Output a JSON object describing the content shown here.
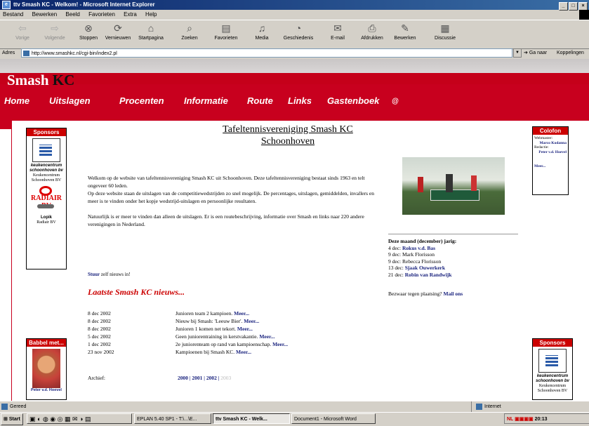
{
  "window": {
    "title": "ttv Smash KC - Welkom! - Microsoft Internet Explorer"
  },
  "menu": [
    "Bestand",
    "Bewerken",
    "Beeld",
    "Favorieten",
    "Extra",
    "Help"
  ],
  "toolbar": {
    "back": "Vorige",
    "forward": "Volgende",
    "stop": "Stoppen",
    "refresh": "Vernieuwen",
    "home": "Startpagina",
    "search": "Zoeken",
    "favorites": "Favorieten",
    "media": "Media",
    "history": "Geschiedenis",
    "mail": "E-mail",
    "print": "Afdrukken",
    "edit": "Bewerken",
    "discuss": "Discussie"
  },
  "address": {
    "label": "Adres",
    "url": "http://www.smashkc.nl/cgi-bin/index2.pl",
    "go": "Ga naar",
    "links": "Koppelingen"
  },
  "site": {
    "name_a": "Smash",
    "name_b": "KC",
    "nav": [
      "Home",
      "Uitslagen",
      "Procenten",
      "Informatie",
      "Route",
      "Links",
      "Gastenboek"
    ],
    "nav_extra": "@",
    "title_line1": "Tafeltennisvereniging Smash KC",
    "title_line2": "Schoonhoven"
  },
  "sponsors_left": {
    "header": "Sponsors",
    "s1_brand": "keukencentrum schoonhoven bv",
    "s1_line1": "Keukencentrum",
    "s1_line2": "Schoonhoven BV",
    "s2_brand": "RADIAIR BV",
    "s2_town": "Lopik",
    "s2_name": "Radiair BV"
  },
  "intro": {
    "p1": "Welkom op de website van tafeltennisvereniging Smash KC uit Schoonhoven. Deze tafeltennisvereniging bestaat sinds 1963 en telt ongeveer 60 leden.",
    "p2": "Op deze website staan de uitslagen van de competitiewedstrijden zo snel mogelijk. De percentages, uitslagen, gemiddelden, invallers en meer is te vinden onder het kopje wedstrijd-uitslagen en persoonlijke resultaten.",
    "p3": "Natuurlijk is er meer te vinden dan alleen de uitslagen. Er is een routebeschrijving, informatie over Smash en links naar 220 andere verenigingen in Nederland."
  },
  "colofon": {
    "header": "Colofon",
    "webmaster_label": "Webmaster:",
    "webmaster": "Marco Kodanna",
    "redactie_label": "Redactie:",
    "redactie": "Peter v.d. Hoevel",
    "more": "Meer..."
  },
  "birthdays": {
    "heading": "Deze maand (december) jarig:",
    "items": [
      {
        "date": "4 dec:",
        "name": "Rokus v.d. Bas",
        "link": true
      },
      {
        "date": "9 dec:",
        "name": "Mark Florisson",
        "link": false
      },
      {
        "date": "9 dec:",
        "name": "Rebecca Florisson",
        "link": false
      },
      {
        "date": "13 dec:",
        "name": "Sjaak Ouwerkerk",
        "link": true
      },
      {
        "date": "21 dec:",
        "name": "Robin van Randwijk",
        "link": true
      }
    ],
    "objection": "Bezwaar tegen plaatsing?",
    "mail": "Mail ons"
  },
  "news": {
    "stuur_link": "Stuur",
    "stuur_rest": "zelf nieuws in!",
    "title": "Laatste Smash KC nieuws...",
    "items": [
      {
        "date": "8 dec 2002",
        "text": "Junioren team 2 kampioen.",
        "more": "Meer..."
      },
      {
        "date": "8 dec 2002",
        "text": "Nieuw bij Smash: 'Leeuw Bier'.",
        "more": "Meer..."
      },
      {
        "date": "8 dec 2002",
        "text": "Junioren 1 komen net tekort.",
        "more": "Meer..."
      },
      {
        "date": "5 dec 2002",
        "text": "Geen juniorentraining in kerstvakantie.",
        "more": "Meer..."
      },
      {
        "date": "1 dec 2002",
        "text": "2e juniorenteam op rand van kampioenschap.",
        "more": "Meer..."
      },
      {
        "date": "23 nov 2002",
        "text": "Kampioenen bij Smash KC.",
        "more": "Meer..."
      }
    ],
    "archive_label": "Archief:",
    "archive_years": [
      "2000",
      "2001",
      "2002",
      "2003"
    ]
  },
  "babbel": {
    "header": "Babbel met...",
    "name": "Peter v.d. Hoevel"
  },
  "sponsors_right": {
    "header": "Sponsors",
    "brand": "keukencentrum schoonhoven bv",
    "line1": "Keukencentrum",
    "line2": "Schoonhoven BV"
  },
  "status": {
    "left": "Gereed",
    "zone": "Internet"
  },
  "taskbar": {
    "start": "Start",
    "tasks": [
      "EPLAN 5.40 SP1 - T:\\...\\E...",
      "ttv Smash KC - Welk...",
      "Document1 - Microsoft Word"
    ],
    "tray_text": "NL",
    "time": "20:13"
  }
}
